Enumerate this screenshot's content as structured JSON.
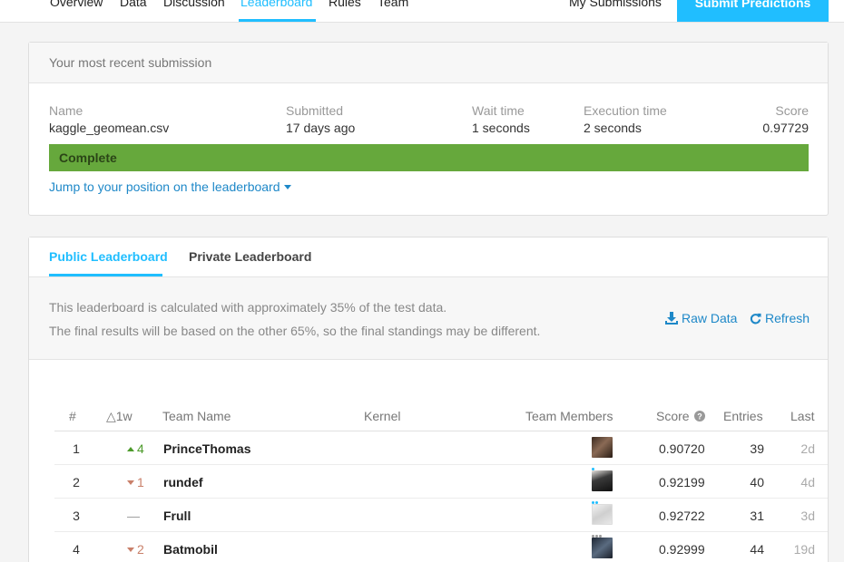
{
  "nav": {
    "tabs": [
      "Overview",
      "Data",
      "Discussion",
      "Leaderboard",
      "Rules",
      "Team"
    ],
    "active_tab": "Leaderboard",
    "my_submissions": "My Submissions",
    "submit_button": "Submit Predictions",
    "accent_color": "#20beff"
  },
  "submission": {
    "header": "Your most recent submission",
    "labels": {
      "name": "Name",
      "submitted": "Submitted",
      "wait_time": "Wait time",
      "execution_time": "Execution time",
      "score": "Score"
    },
    "values": {
      "name": "kaggle_geomean.csv",
      "submitted": "17 days ago",
      "wait_time": "1 seconds",
      "execution_time": "2 seconds",
      "score": "0.97729"
    },
    "status": "Complete",
    "status_color": "#66a83c",
    "jump_link": "Jump to your position on the leaderboard"
  },
  "leaderboard": {
    "tabs": [
      "Public Leaderboard",
      "Private Leaderboard"
    ],
    "active_tab": "Public Leaderboard",
    "info_line_1": "This leaderboard is calculated with approximately 35% of the test data.",
    "info_line_2": "The final results will be based on the other 65%, so the final standings may be different.",
    "raw_data": "Raw Data",
    "refresh": "Refresh",
    "columns": {
      "rank": "#",
      "change": "△1w",
      "team_name": "Team Name",
      "kernel": "Kernel",
      "team_members": "Team Members",
      "score": "Score",
      "entries": "Entries",
      "last": "Last"
    },
    "rows": [
      {
        "rank": "1",
        "change": "4",
        "direction": "up",
        "team": "PrinceThomas",
        "score": "0.90720",
        "entries": "39",
        "last": "2d"
      },
      {
        "rank": "2",
        "change": "1",
        "direction": "down",
        "team": "rundef",
        "score": "0.92199",
        "entries": "40",
        "last": "4d"
      },
      {
        "rank": "3",
        "change": "—",
        "direction": "none",
        "team": "Frull",
        "score": "0.92722",
        "entries": "31",
        "last": "3d"
      },
      {
        "rank": "4",
        "change": "2",
        "direction": "down",
        "team": "Batmobil",
        "score": "0.92999",
        "entries": "44",
        "last": "19d"
      }
    ]
  }
}
